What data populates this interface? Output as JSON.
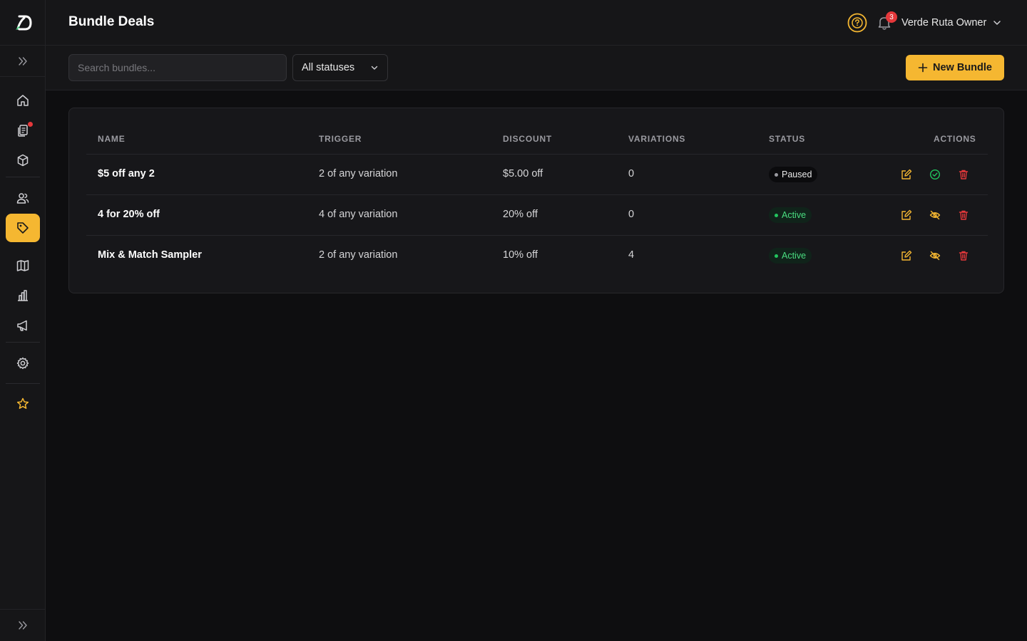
{
  "header": {
    "title": "Bundle Deals",
    "notification_count": "3",
    "user_name": "Verde Ruta Owner"
  },
  "toolbar": {
    "search_placeholder": "Search bundles...",
    "status_filter": "All statuses",
    "new_button_label": "New Bundle"
  },
  "table": {
    "columns": [
      "NAME",
      "TRIGGER",
      "DISCOUNT",
      "VARIATIONS",
      "STATUS",
      "ACTIONS"
    ],
    "rows": [
      {
        "name": "$5 off any 2",
        "trigger": "2 of any variation",
        "discount": "$5.00 off",
        "variations": "0",
        "status": "Paused"
      },
      {
        "name": "4 for 20% off",
        "trigger": "4 of any variation",
        "discount": "20% off",
        "variations": "0",
        "status": "Active"
      },
      {
        "name": "Mix & Match Sampler",
        "trigger": "2 of any variation",
        "discount": "10% off",
        "variations": "4",
        "status": "Active"
      }
    ]
  },
  "sidebar": {
    "items": [
      "home-icon",
      "orders-icon",
      "products-icon",
      "customers-icon",
      "tag-icon",
      "catalog-icon",
      "reports-icon",
      "marketing-icon",
      "settings-icon",
      "star-icon"
    ],
    "active_item": "tag-icon"
  },
  "colors": {
    "accent": "#f5b731",
    "active_green": "#22c55e",
    "danger": "#e5383b"
  }
}
